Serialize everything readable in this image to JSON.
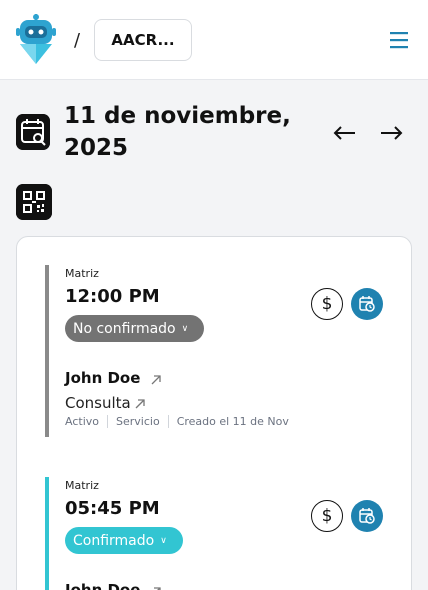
{
  "header": {
    "separator": "/",
    "org_label": "AACR..."
  },
  "calendar": {
    "date_line1": "11 de noviembre,",
    "date_line2": "2025",
    "prev_label": "⟵",
    "next_label": "⟶"
  },
  "appointments": [
    {
      "location": "Matriz",
      "time": "12:00 PM",
      "status": "No confirmado",
      "status_color": "#737373",
      "bar_color": "#8a8a8a",
      "pay_symbol": "$",
      "client": "John Doe",
      "service": "Consulta",
      "meta": [
        "Activo",
        "Servicio",
        "Creado el 11 de Nov"
      ]
    },
    {
      "location": "Matriz",
      "time": "05:45 PM",
      "status": "Confirmado",
      "status_color": "#32c5d2",
      "bar_color": "#32c5d2",
      "pay_symbol": "$",
      "client": "John Doe"
    }
  ],
  "colors": {
    "accent": "#1f82b0",
    "logo": "#2ea3d0"
  }
}
